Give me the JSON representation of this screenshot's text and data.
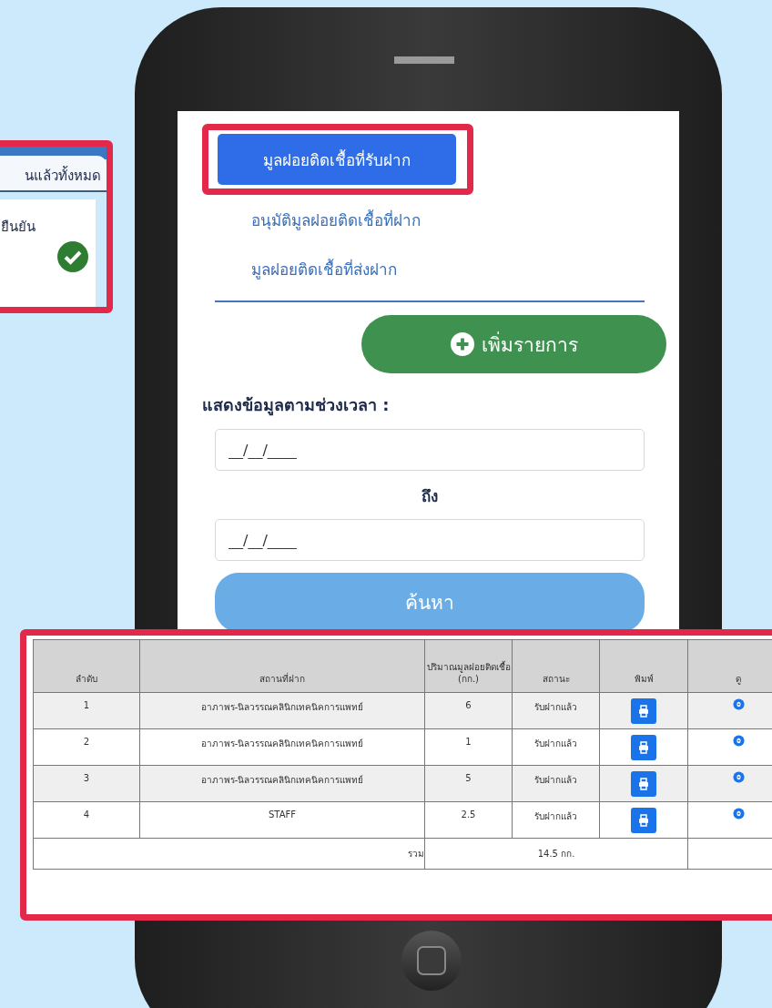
{
  "inset": {
    "tab_label": "นแล้วทั้งหมด",
    "text": "ยืนยัน",
    "confirmed": true
  },
  "tabs": [
    {
      "label": "มูลฝอยติดเชื้อที่รับฝาก",
      "selected": true
    },
    {
      "label": "อนุมัติมูลฝอยติดเชื้อที่ฝาก",
      "selected": false
    },
    {
      "label": "มูลฝอยติดเชื้อที่ส่งฝาก",
      "selected": false
    }
  ],
  "add_button": "เพิ่มรายการ",
  "date_range": {
    "label": "แสดงข้อมูลตามช่วงเวลา :",
    "from": {
      "placeholder": "__/__/____"
    },
    "to_label": "ถึง",
    "to": {
      "placeholder": "__/__/____"
    }
  },
  "search_button": "ค้นหา",
  "table": {
    "columns": [
      "ลำดับ",
      "สถานที่ฝาก",
      "ปริมาณมูลฝอยติดเชื้อ (กก.)",
      "สถานะ",
      "พิมพ์",
      "ดู"
    ],
    "rows": [
      {
        "no": "1",
        "place": "อาภาพร-นิลวรรณคลินิกเทคนิคการแพทย์",
        "amount": "6",
        "status": "รับฝากแล้ว"
      },
      {
        "no": "2",
        "place": "อาภาพร-นิลวรรณคลินิกเทคนิคการแพทย์",
        "amount": "1",
        "status": "รับฝากแล้ว"
      },
      {
        "no": "3",
        "place": "อาภาพร-นิลวรรณคลินิกเทคนิคการแพทย์",
        "amount": "5",
        "status": "รับฝากแล้ว"
      },
      {
        "no": "4",
        "place": "STAFF",
        "amount": "2.5",
        "status": "รับฝากแล้ว"
      }
    ],
    "total_label": "รวม",
    "total_value": "14.5 กก."
  }
}
